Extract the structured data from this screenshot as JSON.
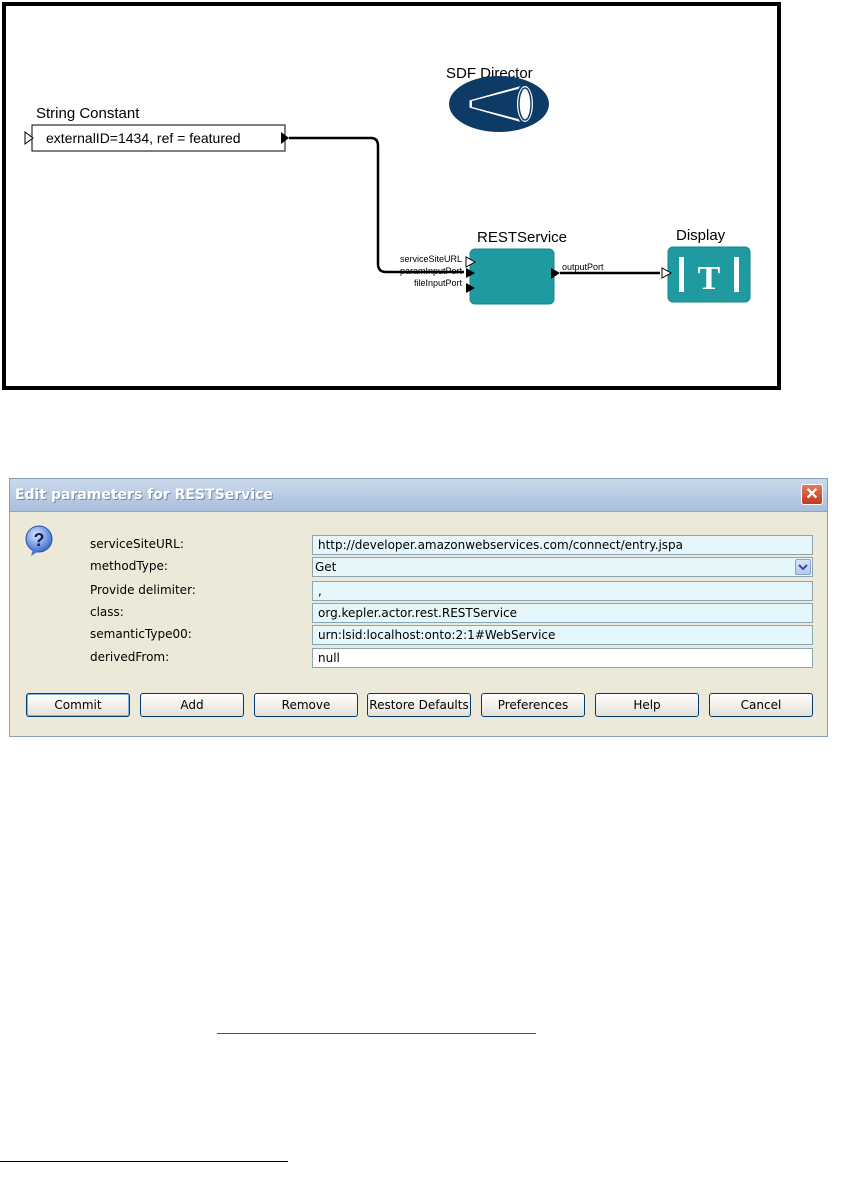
{
  "workflow": {
    "director_label": "SDF Director",
    "string_constant": {
      "title": "String Constant",
      "value": "externalID=1434, ref = featured"
    },
    "rest_service": {
      "title": "RESTService",
      "input_ports": [
        "serviceSiteURL",
        "paramInputPort",
        "fileInputPort"
      ],
      "output_port": "outputPort",
      "color": "#1e9aa0"
    },
    "display": {
      "title": "Display",
      "glyph": "|T|",
      "color": "#1e9aa0"
    }
  },
  "dialog": {
    "title": "Edit parameters for RESTService",
    "close_glyph": "✕",
    "icon": "question-icon",
    "params": [
      {
        "label": "serviceSiteURL:",
        "value": "http://developer.amazonwebservices.com/connect/entry.jspa"
      },
      {
        "label": "methodType:",
        "value": "Get"
      },
      {
        "label": "Provide delimiter:",
        "value": ","
      },
      {
        "label": "class:",
        "value": "org.kepler.actor.rest.RESTService"
      },
      {
        "label": "semanticType00:",
        "value": "urn:lsid:localhost:onto:2:1#WebService"
      },
      {
        "label": "derivedFrom:",
        "value": "null"
      }
    ],
    "buttons": {
      "commit": "Commit",
      "add": "Add",
      "remove": "Remove",
      "restore": "Restore Defaults",
      "preferences": "Preferences",
      "help": "Help",
      "cancel": "Cancel"
    }
  }
}
